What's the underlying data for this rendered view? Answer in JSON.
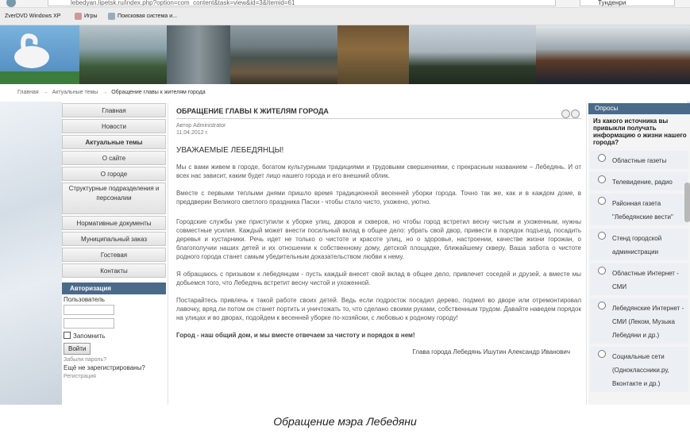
{
  "browser": {
    "address": "lebedyan.lipetsk.ru/index.php?option=com_content&task=view&id=3&Itemid=61",
    "search_value": "Тунденри",
    "bookmarks": [
      "ZverDVD Windows XP",
      "Игры",
      "Поисковая система и..."
    ]
  },
  "breadcrumb": {
    "home": "Главная",
    "section": "Актуальные темы",
    "current": "Обращение главы к жителям города",
    "separator": "→"
  },
  "menu": {
    "items": [
      {
        "label": "Главная"
      },
      {
        "label": "Новости"
      },
      {
        "label": "Актуальные темы",
        "active": true
      },
      {
        "label": "О сайте"
      },
      {
        "label": "О городе"
      },
      {
        "label": "Структурные подразделения и персоналии",
        "multi": true
      },
      {
        "label": "Нормативные документы"
      },
      {
        "label": "Муниципальный заказ"
      },
      {
        "label": "Гостевая"
      },
      {
        "label": "Контакты"
      }
    ]
  },
  "auth": {
    "title": "Авторизация",
    "user_label": "Пользователь",
    "remember_label": "Запомнить",
    "login_button": "Войти",
    "forgot": "Забыли пароль?",
    "not_registered": "Ещё не зарегистрированы?",
    "register": "Регистрация"
  },
  "article": {
    "title": "ОБРАЩЕНИЕ ГЛАВЫ К ЖИТЕЛЯМ ГОРОДА",
    "author": "Автор Administrator",
    "date": "11.04.2012 г.",
    "salutation": "УВАЖАЕМЫЕ ЛЕБЕДЯНЦЫ!",
    "paragraphs": [
      "Мы с вами живем в городе, богатом культурными традициями и трудовыми свершениями, с прекрасным названием – Лебедянь. И от всех нас зависит, каким будет лицо нашего города и его внешний облик.",
      "Вместе с первыми теплыми днями пришло время традиционной весенней уборки города. Точно так же, как и в каждом доме, в преддверии Великого светлого праздника Пасхи - чтобы стало чисто, ухожено, уютно.",
      "Городские службы уже приступили к уборке улиц, дворов и скверов, но чтобы город встретил весну чистым и ухоженным, нужны совместные усилия. Каждый может внести посильный вклад в общее дело: убрать свой двор, привести в порядок подъезд, посадить деревья и кустарники. Речь идет не только о чистоте и красоте улиц, но о здоровье, настроении, качестве жизни горожан, о благополучии наших детей и их отношении к собственному дому, детской площадке, ближайшему скверу. Ваша забота о чистоте родного города станет самым убедительным доказательством любви к нему.",
      "Я обращаюсь с призывом к лебедянцам - пусть каждый внесет свой вклад в общее дело, привлечет соседей и друзей, а вместе мы добьемся того, что Лебедянь встретит весну чистой и ухоженной.",
      "Постарайтесь привлечь к такой работе своих детей. Ведь если подросток посадил дерево, подмел во дворе или отремонтировал лавочку, вряд ли потом он станет портить и уничтожать то, что сделано своими руками, собственным трудом. Давайте наведем порядок на улицах и во дворах, подойдем к весенней уборке по-хозяйски, с любовью к родному городу!"
    ],
    "closing": "Город - наш общий дом, и мы вместе отвечаем за чистоту и порядок в нем!",
    "signature": "Глава города Лебедянь Ишутин Александр Иванович"
  },
  "poll": {
    "title": "Опросы",
    "question": "Из какого источника вы привыкли получать информацию о жизни нашего города?",
    "options": [
      "Областные газеты",
      "Телевидение, радио",
      "Районная газета \"Лебедянские вести\"",
      "Стенд городской администрации",
      "Областные Интернет - СМИ",
      "Лебедянские Интернет - СМИ (Леком, Музыка Лебедяни и др.)",
      "Социальные сети (Одноклассники.ру, Вконтакте и др.)"
    ]
  },
  "caption": "Обращение мэра Лебедяни"
}
